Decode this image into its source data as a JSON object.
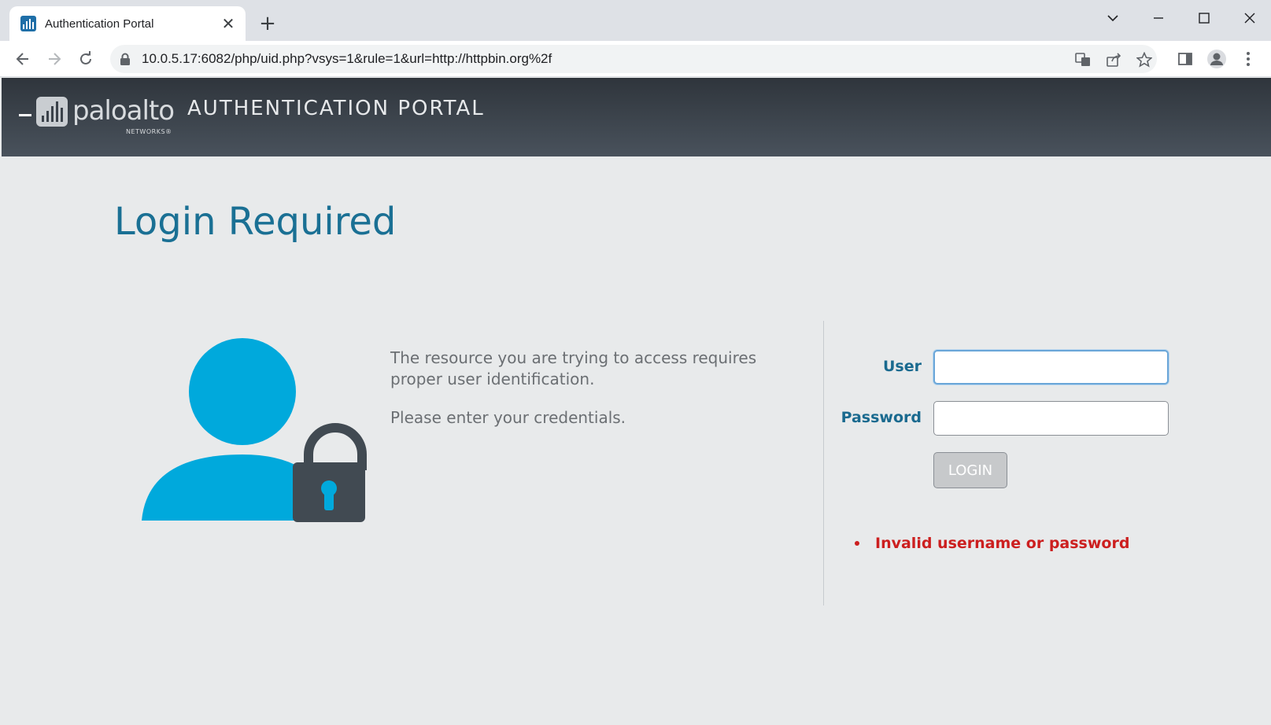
{
  "browser": {
    "tab_title": "Authentication Portal",
    "tab_close": "✕",
    "new_tab": "+",
    "url": "10.0.5.17:6082/php/uid.php?vsys=1&rule=1&url=http://httpbin.org%2f"
  },
  "portal": {
    "brand": "paloalto",
    "brand_sub": "NETWORKS®",
    "header_title": "AUTHENTICATION PORTAL",
    "page_title": "Login Required",
    "message_line1": "The resource you are trying to access requires proper user identification.",
    "message_line2": "Please enter your credentials."
  },
  "form": {
    "user_label": "User",
    "password_label": "Password",
    "user_value": "",
    "password_value": "",
    "login_label": "LOGIN",
    "error": "Invalid username or password"
  },
  "colors": {
    "accent": "#1a7094",
    "icon_blue": "#00a9dc",
    "lock_gray": "#414a52",
    "error": "#cc1f1f"
  }
}
